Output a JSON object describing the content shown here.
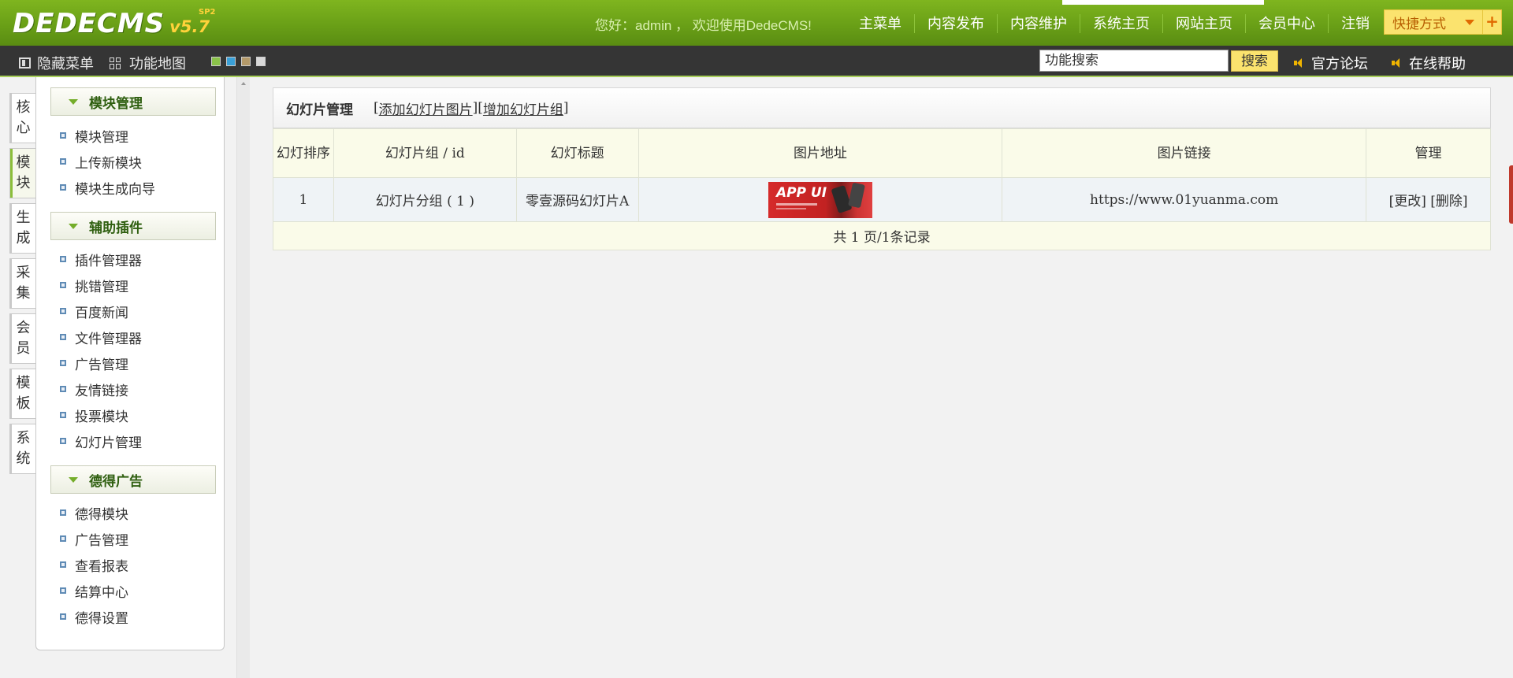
{
  "header": {
    "logo_text": "DEDECMS",
    "logo_version": "v5.7",
    "logo_sup": "SP2",
    "welcome": "您好：admin ， 欢迎使用DedeCMS!",
    "nav": [
      "主菜单",
      "内容发布",
      "内容维护",
      "系统主页",
      "网站主页",
      "会员中心",
      "注销"
    ],
    "quick_label": "快捷方式",
    "quick_plus": "+"
  },
  "subbar": {
    "hide_menu": "隐藏菜单",
    "func_map": "功能地图",
    "swatch_colors": [
      "#8bc34a",
      "#3aa0d8",
      "#b49a6a",
      "#d8d8d8"
    ],
    "search_value": "功能搜索",
    "search_button": "搜索",
    "forum": "官方论坛",
    "help": "在线帮助"
  },
  "vtabs": [
    {
      "l1": "核",
      "l2": "心"
    },
    {
      "l1": "模",
      "l2": "块"
    },
    {
      "l1": "生",
      "l2": "成"
    },
    {
      "l1": "采",
      "l2": "集"
    },
    {
      "l1": "会",
      "l2": "员"
    },
    {
      "l1": "模",
      "l2": "板"
    },
    {
      "l1": "系",
      "l2": "统"
    }
  ],
  "menu": {
    "groups": [
      {
        "title": "模块管理",
        "items": [
          "模块管理",
          "上传新模块",
          "模块生成向导"
        ]
      },
      {
        "title": "辅助插件",
        "items": [
          "插件管理器",
          "挑错管理",
          "百度新闻",
          "文件管理器",
          "广告管理",
          "友情链接",
          "投票模块",
          "幻灯片管理"
        ]
      },
      {
        "title": "德得广告",
        "items": [
          "德得模块",
          "广告管理",
          "查看报表",
          "结算中心",
          "德得设置"
        ]
      }
    ]
  },
  "main": {
    "title": "幻灯片管理",
    "link_add_image": "添加幻灯片图片",
    "link_add_group": "增加幻灯片组",
    "bracket_open": "[",
    "bracket_close": "]",
    "columns": [
      "幻灯排序",
      "幻灯片组 / id",
      "幻灯标题",
      "图片地址",
      "图片链接",
      "管理"
    ],
    "rows": [
      {
        "order": "1",
        "group": "幻灯片分组 ( 1 )",
        "title": "零壹源码幻灯片A",
        "image_text": "APP UI",
        "link": "https://www.01yuanma.com",
        "edit": "[更改]",
        "delete": "[删除]"
      }
    ],
    "footer": "共 1 页/1条记录"
  }
}
